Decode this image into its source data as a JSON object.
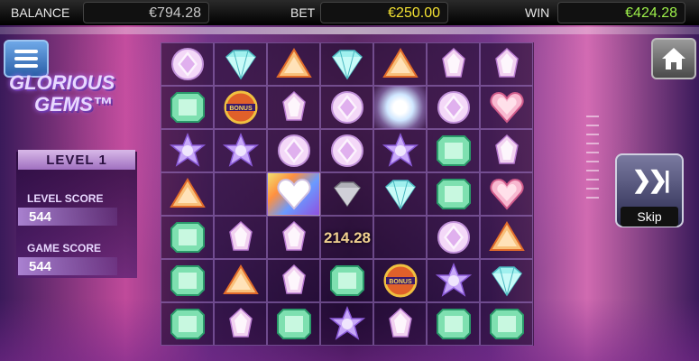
{
  "topbar": {
    "balance_label": "BALANCE",
    "balance_value": "€794.28",
    "bet_label": "BET",
    "bet_value": "€250.00",
    "win_label": "WIN",
    "win_value": "€424.28"
  },
  "logo": {
    "line1": "GLORIOUS",
    "line2": "GEMS™"
  },
  "panel": {
    "level": "LEVEL 1",
    "level_score_label": "LEVEL SCORE",
    "level_score_value": "544",
    "game_score_label": "GAME SCORE",
    "game_score_value": "544"
  },
  "grid": {
    "win_amount": "214.28",
    "bonus_text": "BONUS",
    "rows": [
      [
        "round-pink",
        "diamond-cyan",
        "triangle-orange",
        "diamond-cyan",
        "triangle-orange",
        "drop-pink",
        "drop-pink"
      ],
      [
        "emerald-green",
        "bonus",
        "drop-pink",
        "round-pink",
        "flash",
        "round-pink",
        "heart-pink"
      ],
      [
        "star-purple",
        "star-purple",
        "round-pink",
        "round-pink",
        "star-purple",
        "emerald-green",
        "drop-pink"
      ],
      [
        "triangle-orange",
        "empty",
        "heart-gold",
        "diamond-gray",
        "diamond-cyan",
        "emerald-green",
        "heart-pink"
      ],
      [
        "emerald-green",
        "drop-pink",
        "drop-pink",
        "empty",
        "empty",
        "round-pink",
        "triangle-orange"
      ],
      [
        "emerald-green",
        "triangle-orange",
        "drop-pink",
        "emerald-green",
        "bonus",
        "star-purple",
        "diamond-cyan"
      ],
      [
        "emerald-green",
        "drop-pink",
        "emerald-green",
        "star-purple",
        "drop-pink",
        "emerald-green",
        "emerald-green"
      ]
    ]
  },
  "controls": {
    "skip_label": "Skip",
    "menu_icon": "hamburger-menu-icon",
    "home_icon": "home-icon",
    "skip_icon": "fast-forward-icon"
  },
  "colors": {
    "accent_gold": "#f4e232",
    "win_green": "#9df04a",
    "menu_blue": "#2a5fa8"
  }
}
